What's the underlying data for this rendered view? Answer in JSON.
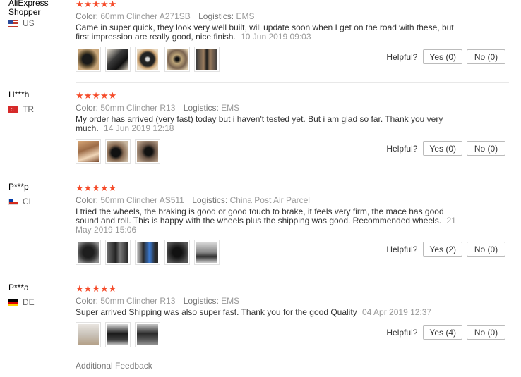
{
  "reviews": [
    {
      "user": "AliExpress Shopper",
      "country": "US",
      "stars": "★★★★★",
      "color_label": "Color:",
      "color_value": "60mm Clincher A271SB",
      "logistics_label": "Logistics:",
      "logistics_value": "EMS",
      "text": "Came in super quick, they look very well built, will update soon when I get on the road with these, but first impression are really good, nice finish.",
      "date": "10 Jun 2019 09:03",
      "helpful_label": "Helpful?",
      "yes_label": "Yes (0)",
      "no_label": "No (0)"
    },
    {
      "user": "H***h",
      "country": "TR",
      "stars": "★★★★★",
      "color_label": "Color:",
      "color_value": "50mm Clincher R13",
      "logistics_label": "Logistics:",
      "logistics_value": "EMS",
      "text": "My order has arrived (very fast) today but i haven't tested yet. But i am glad so far. Thank you very much.",
      "date": "14 Jun 2019 12:18",
      "helpful_label": "Helpful?",
      "yes_label": "Yes (0)",
      "no_label": "No (0)"
    },
    {
      "user": "P***p",
      "country": "CL",
      "stars": "★★★★★",
      "color_label": "Color:",
      "color_value": "50mm Clincher AS511",
      "logistics_label": "Logistics:",
      "logistics_value": "China Post Air Parcel",
      "text": "I tried the wheels, the braking is good or good touch to brake, it feels very firm, the mace has good sound and roll. This is happy with the wheels plus the shipping was good. Recommended wheels.",
      "date": "21 May 2019 15:06",
      "helpful_label": "Helpful?",
      "yes_label": "Yes (2)",
      "no_label": "No (0)"
    },
    {
      "user": "P***a",
      "country": "DE",
      "stars": "★★★★★",
      "color_label": "Color:",
      "color_value": "50mm Clincher R13",
      "logistics_label": "Logistics:",
      "logistics_value": "EMS",
      "text": "Super arrived Shipping was also super fast. Thank you for the good Quality",
      "date": "04 Apr 2019 12:37",
      "helpful_label": "Helpful?",
      "yes_label": "Yes (4)",
      "no_label": "No (0)"
    }
  ],
  "additional_feedback": "Additional Feedback",
  "colors": {
    "star": "#f54b2a",
    "meta": "#999999",
    "border": "#bbbbbb"
  }
}
